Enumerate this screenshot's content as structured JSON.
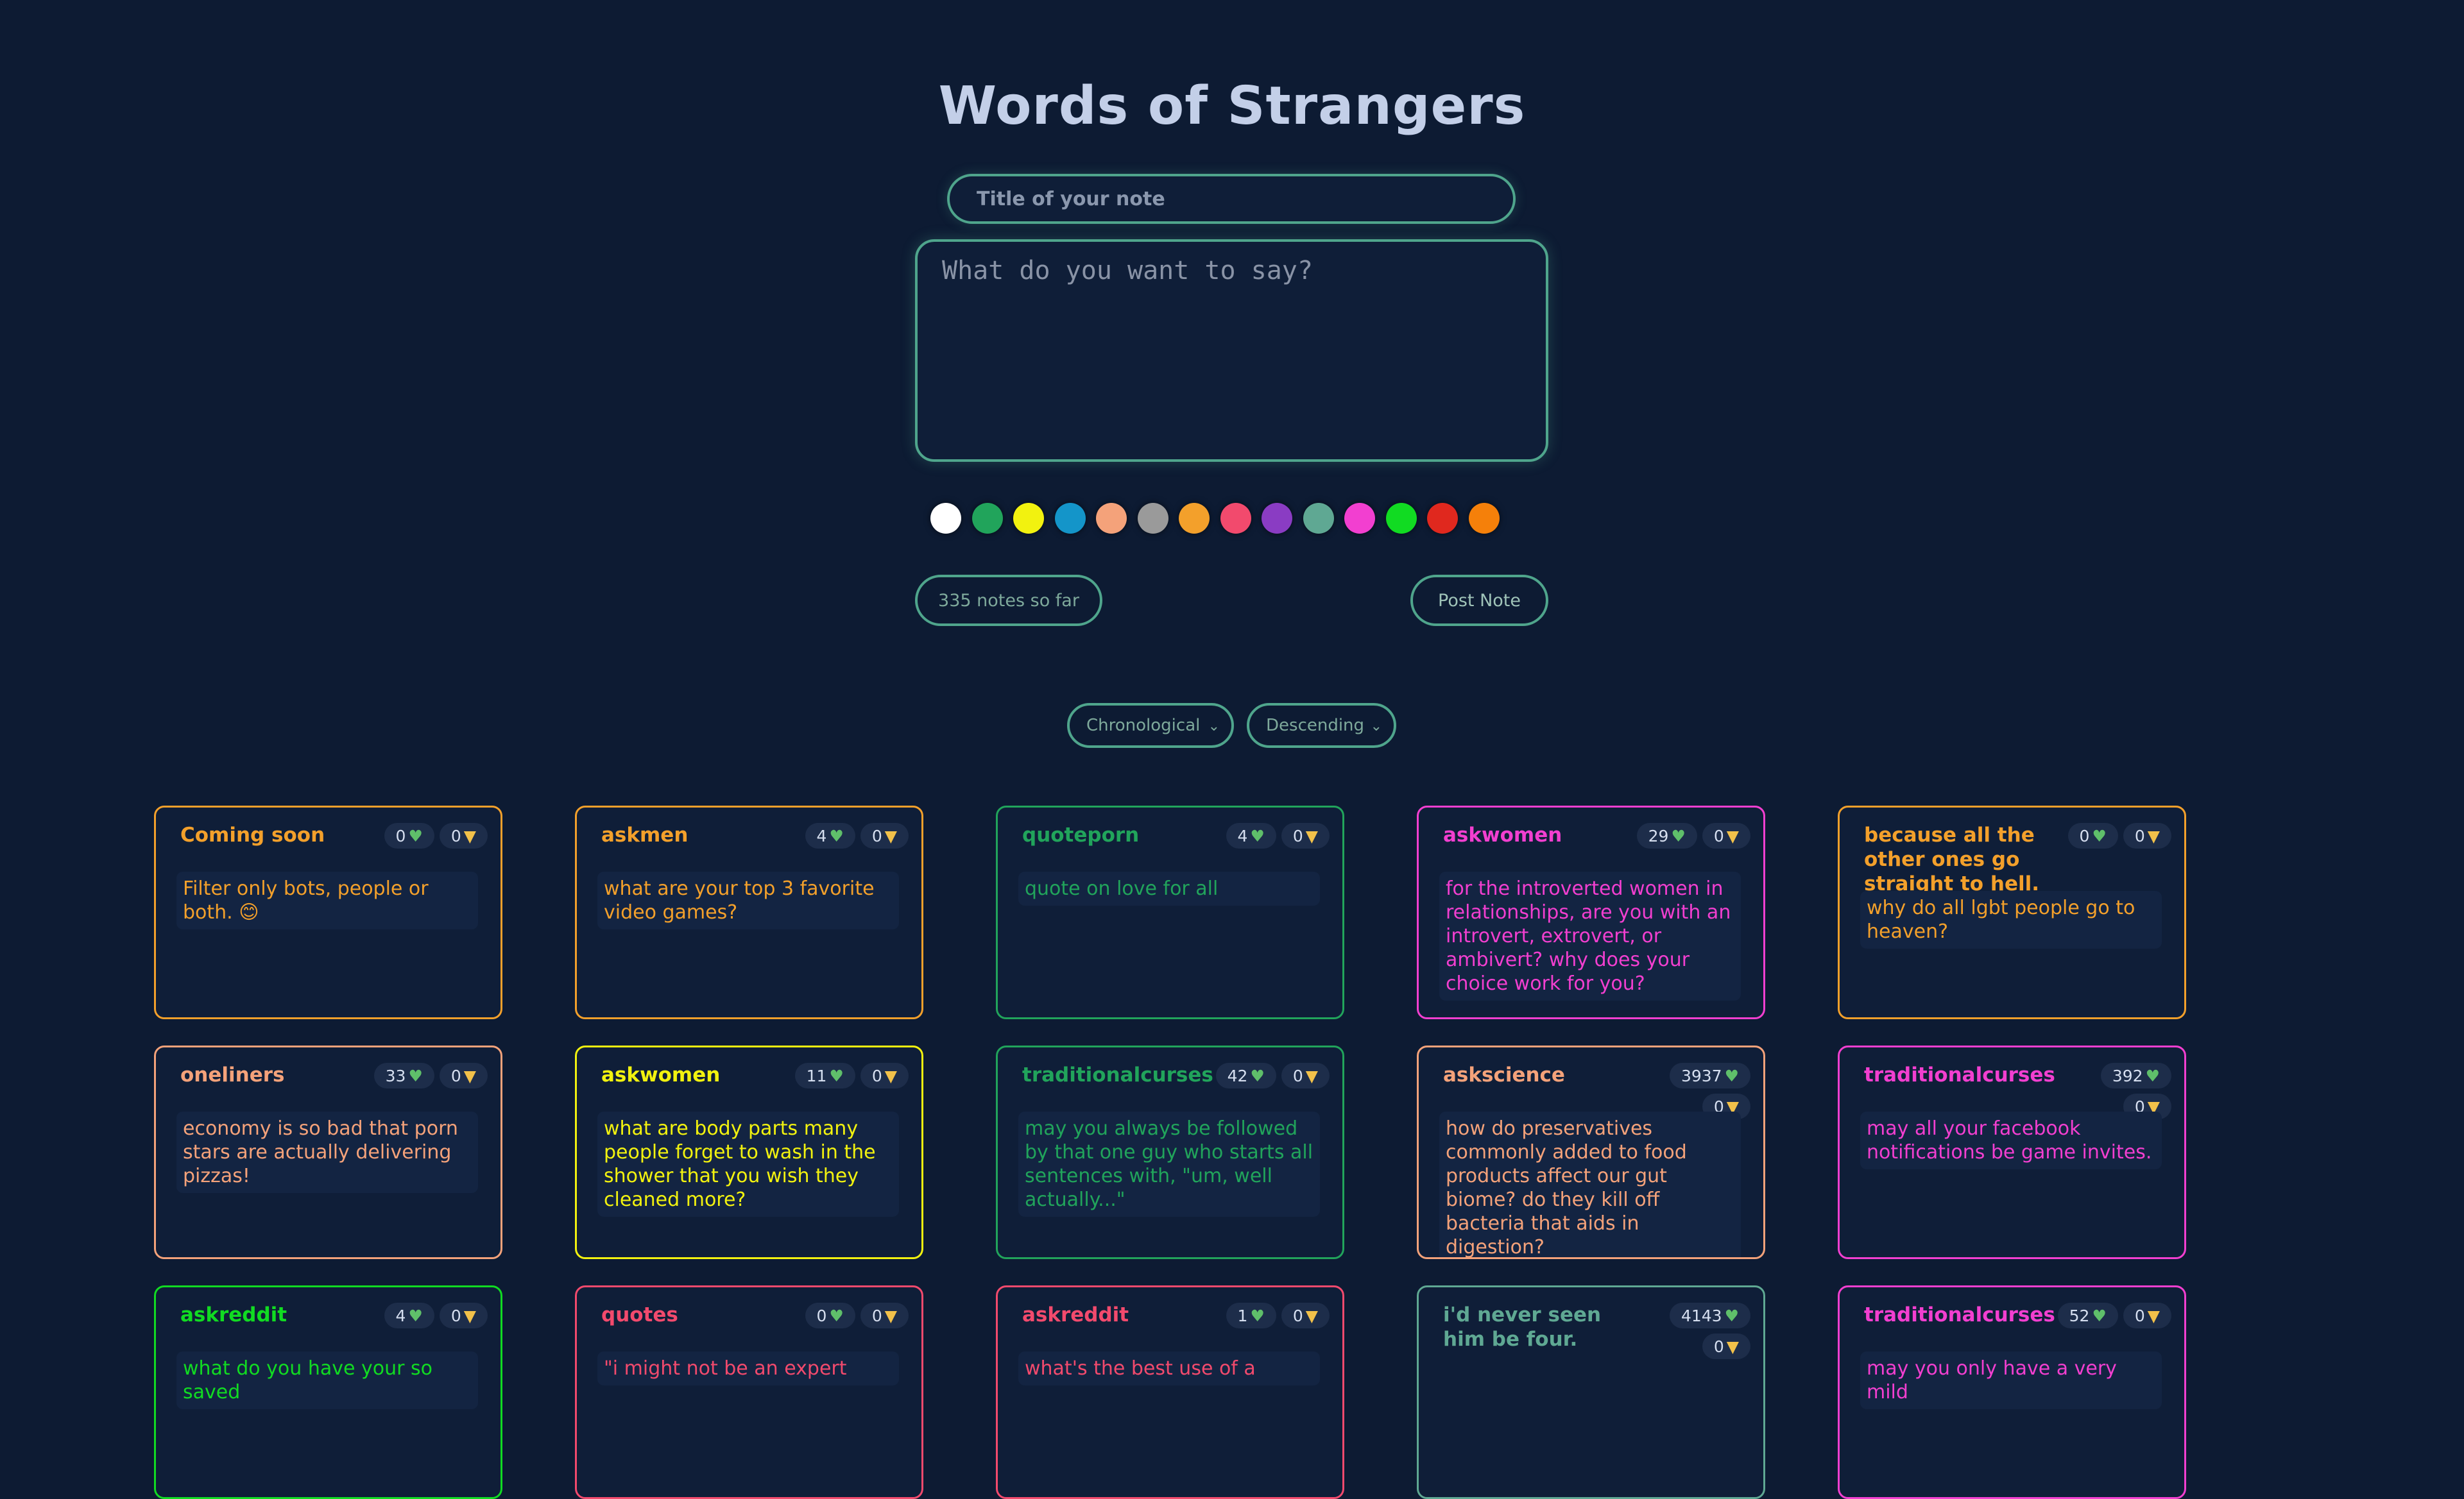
{
  "app": {
    "title": "Words of Strangers"
  },
  "form": {
    "title_placeholder": "Title of your note",
    "body_placeholder": "What do you want to say?",
    "colors": [
      "#ffffff",
      "#21a45b",
      "#f2f20f",
      "#1495c9",
      "#f4a27a",
      "#9a9a9a",
      "#f3a02b",
      "#f24a6d",
      "#8a3cc3",
      "#5fa893",
      "#f23fd0",
      "#11db22",
      "#e0281e",
      "#f5800a"
    ],
    "count_label": "335 notes so far",
    "post_label": "Post Note"
  },
  "sort": {
    "order_by": "Chronological",
    "direction": "Descending"
  },
  "notes": [
    {
      "title": "Coming soon",
      "likes": "0",
      "dislikes": "0",
      "body": "Filter only bots, people or both. 😊",
      "color": "#f3a02b"
    },
    {
      "title": "askmen",
      "likes": "4",
      "dislikes": "0",
      "body": "what are your top 3 favorite video games?",
      "color": "#f3a02b"
    },
    {
      "title": "quoteporn",
      "likes": "4",
      "dislikes": "0",
      "body": "quote on love for all",
      "color": "#21a45b"
    },
    {
      "title": "askwomen",
      "likes": "29",
      "dislikes": "0",
      "body": "for the introverted women in relationships, are you with an introvert, extrovert, or ambivert? why does your choice work for you?",
      "color": "#f23fd0"
    },
    {
      "title": "because all the other ones go straight to hell.",
      "likes": "0",
      "dislikes": "0",
      "body": "why do all lgbt people go to heaven?",
      "color": "#f3a02b"
    },
    {
      "title": "oneliners",
      "likes": "33",
      "dislikes": "0",
      "body": "economy is so bad that porn stars are actually delivering pizzas!",
      "color": "#f4a27a"
    },
    {
      "title": "askwomen",
      "likes": "11",
      "dislikes": "0",
      "body": "what are body parts many people forget to wash in the shower that you wish they cleaned more?",
      "color": "#f2f20f"
    },
    {
      "title": "traditionalcurses",
      "likes": "42",
      "dislikes": "0",
      "body": "may you always be followed by that one guy who starts all sentences with, \"um, well actually...\"",
      "color": "#21a45b"
    },
    {
      "title": "askscience",
      "likes": "3937",
      "dislikes": "0",
      "body": "how do preservatives commonly added to food products affect our gut biome? do they kill off bacteria that aids in digestion?",
      "color": "#f4a27a"
    },
    {
      "title": "traditionalcurses",
      "likes": "392",
      "dislikes": "0",
      "body": "may all your facebook notifications be game invites.",
      "color": "#f23fd0"
    },
    {
      "title": "askreddit",
      "likes": "4",
      "dislikes": "0",
      "body": "what do you have your so saved",
      "color": "#11db22"
    },
    {
      "title": "quotes",
      "likes": "0",
      "dislikes": "0",
      "body": "\"i might not be an expert",
      "color": "#f24a6d"
    },
    {
      "title": "askreddit",
      "likes": "1",
      "dislikes": "0",
      "body": "what's the best use of a",
      "color": "#f24a6d"
    },
    {
      "title": "i'd never seen him be four.",
      "likes": "4143",
      "dislikes": "0",
      "body": "",
      "color": "#5fa893"
    },
    {
      "title": "traditionalcurses",
      "likes": "52",
      "dislikes": "0",
      "body": "may you only have a very mild",
      "color": "#f23fd0"
    }
  ]
}
